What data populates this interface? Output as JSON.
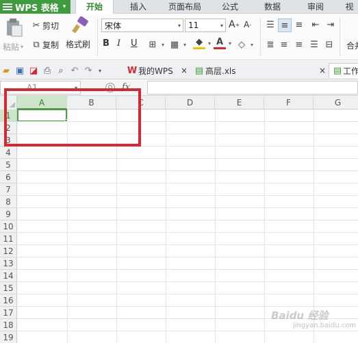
{
  "app": {
    "title": "WPS 表格",
    "accent": "#3f9b3c"
  },
  "menu": {
    "tabs": [
      "开始",
      "插入",
      "页面布局",
      "公式",
      "数据",
      "审阅",
      "视"
    ],
    "active": "开始"
  },
  "ribbon": {
    "paste": "粘贴",
    "cut": "剪切",
    "copy": "复制",
    "format_painter": "格式刷",
    "font_name": "宋体",
    "font_size": "11",
    "merge": "合并"
  },
  "quickbar": {
    "tabs": [
      {
        "label": "我的WPS",
        "icon": "wps-logo-icon"
      },
      {
        "label": "高层.xls",
        "icon": "spreadsheet-icon"
      },
      {
        "label": "工作",
        "icon": "spreadsheet-icon"
      }
    ]
  },
  "formula_bar": {
    "name_box": "A1",
    "fx": "fx",
    "value": ""
  },
  "sheet": {
    "columns": [
      "A",
      "B",
      "C",
      "D",
      "E",
      "F",
      "G"
    ],
    "rows": [
      "1",
      "2",
      "3",
      "4",
      "5",
      "6",
      "7",
      "8",
      "9",
      "10",
      "11",
      "12",
      "13",
      "14",
      "15",
      "16",
      "17",
      "18",
      "19"
    ],
    "active_cell": "A1",
    "annotation_color": "#d42a2f"
  },
  "watermark": {
    "text": "Baidu 经验",
    "sub": "jingyan.baidu.com"
  }
}
